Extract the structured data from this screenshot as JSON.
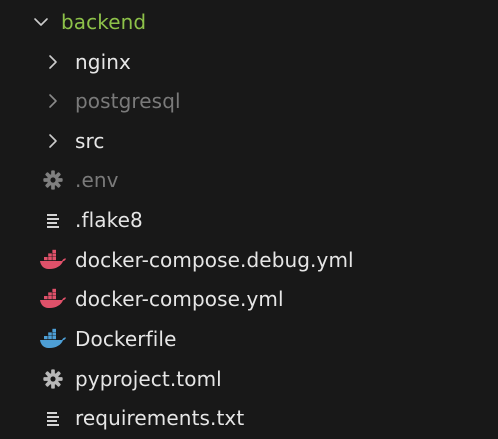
{
  "explorer": {
    "root": {
      "label": "backend",
      "expanded": true,
      "label_color": "#8dc149"
    },
    "items": [
      {
        "label": "nginx",
        "type": "folder",
        "icon": "chevron-right-icon",
        "dimmed": false
      },
      {
        "label": "postgresql",
        "type": "folder",
        "icon": "chevron-right-icon",
        "dimmed": true
      },
      {
        "label": "src",
        "type": "folder",
        "icon": "chevron-right-icon",
        "dimmed": false
      },
      {
        "label": ".env",
        "type": "file",
        "icon": "gear-icon",
        "dimmed": true
      },
      {
        "label": ".flake8",
        "type": "file",
        "icon": "lines-icon",
        "dimmed": false
      },
      {
        "label": "docker-compose.debug.yml",
        "type": "file",
        "icon": "docker-icon",
        "icon_color": "#e0516a",
        "dimmed": false
      },
      {
        "label": "docker-compose.yml",
        "type": "file",
        "icon": "docker-icon",
        "icon_color": "#e0516a",
        "dimmed": false
      },
      {
        "label": "Dockerfile",
        "type": "file",
        "icon": "docker-icon",
        "icon_color": "#4d9fd6",
        "dimmed": false
      },
      {
        "label": "pyproject.toml",
        "type": "file",
        "icon": "gear-icon",
        "dimmed": false
      },
      {
        "label": "requirements.txt",
        "type": "file",
        "icon": "lines-icon",
        "dimmed": false
      }
    ]
  },
  "colors": {
    "background": "#181818",
    "text": "#e6e6e6",
    "text_dimmed": "#7a7a7a",
    "chevron": "#cccccc",
    "gear": "#b8b8b8",
    "docker_red": "#e0516a",
    "docker_blue": "#4d9fd6"
  }
}
